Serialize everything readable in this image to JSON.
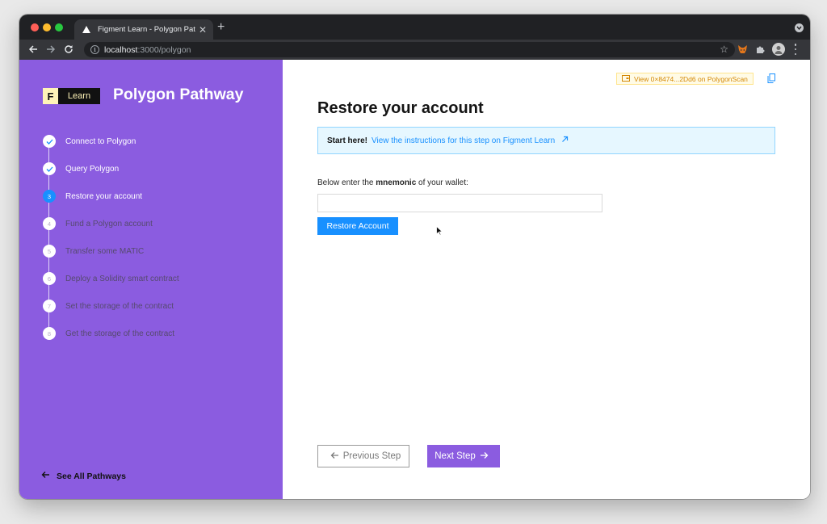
{
  "browser": {
    "tab_title": "Figment Learn - Polygon Pathw",
    "url_host": "localhost",
    "url_path": ":3000/polygon"
  },
  "sidebar": {
    "brand_f": "F",
    "brand_learn": "Learn",
    "title": "Polygon Pathway",
    "steps": [
      {
        "number": "1",
        "label": "Connect to Polygon",
        "status": "done"
      },
      {
        "number": "2",
        "label": "Query Polygon",
        "status": "done"
      },
      {
        "number": "3",
        "label": "Restore your account",
        "status": "current"
      },
      {
        "number": "4",
        "label": "Fund a Polygon account",
        "status": "todo"
      },
      {
        "number": "5",
        "label": "Transfer some MATIC",
        "status": "todo"
      },
      {
        "number": "6",
        "label": "Deploy a Solidity smart contract",
        "status": "todo"
      },
      {
        "number": "7",
        "label": "Set the storage of the contract",
        "status": "todo"
      },
      {
        "number": "8",
        "label": "Get the storage of the contract",
        "status": "todo"
      }
    ],
    "see_all": "See All Pathways"
  },
  "main": {
    "scan_badge": "View 0×8474...2Dd6 on PolygonScan",
    "title": "Restore your account",
    "alert_strong": "Start here!",
    "alert_link": "View the instructions for this step on Figment Learn",
    "prompt_before": "Below enter the ",
    "prompt_bold": "mnemonic",
    "prompt_after": " of your wallet:",
    "mnemonic_value": "",
    "restore_label": "Restore Account",
    "prev_label": "Previous Step",
    "next_label": "Next Step"
  },
  "colors": {
    "sidebar_bg": "#8b5ce0",
    "primary_blue": "#1890ff",
    "next_button": "#8b5ce0",
    "badge_text": "#d48806"
  }
}
